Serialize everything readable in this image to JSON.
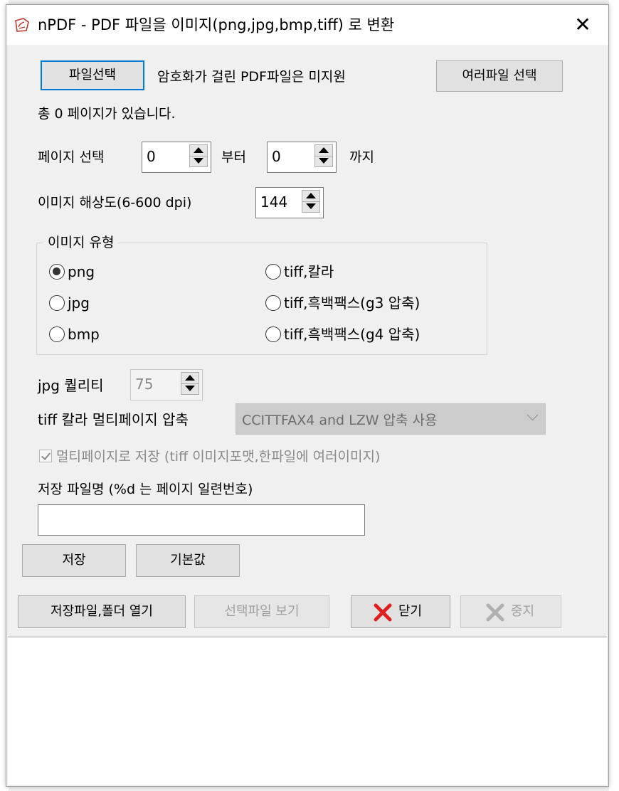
{
  "window": {
    "title": "nPDF - PDF 파일을 이미지(png,jpg,bmp,tiff) 로 변환",
    "close_glyph": "✕"
  },
  "file": {
    "select_button": "파일선택",
    "note": "암호화가 걸린 PDF파일은 미지원",
    "multi_select_button": "여러파일 선택",
    "page_count_text": "총 0 페이지가 있습니다."
  },
  "page_range": {
    "label": "페이지 선택",
    "from_value": "0",
    "from_suffix": "부터",
    "to_value": "0",
    "to_suffix": "까지"
  },
  "resolution": {
    "label": "이미지 해상도(6-600 dpi)",
    "value": "144"
  },
  "image_type": {
    "group_label": "이미지 유형",
    "options": [
      {
        "label": "png",
        "selected": true
      },
      {
        "label": "jpg",
        "selected": false
      },
      {
        "label": "bmp",
        "selected": false
      },
      {
        "label": "tiff,칼라",
        "selected": false
      },
      {
        "label": "tiff,흑백팩스(g3 압축)",
        "selected": false
      },
      {
        "label": "tiff,흑백팩스(g4 압축)",
        "selected": false
      }
    ]
  },
  "jpg_quality": {
    "label": "jpg 퀄리티",
    "value": "75"
  },
  "tiff_compression": {
    "label": "tiff 칼라 멀티페이지 압축",
    "selected": "CCITTFAX4 and LZW 압축 사용"
  },
  "multipage": {
    "label": "멀티페이지로 저장 (tiff 이미지포맷,한파일에 여러이미지)",
    "checked": true
  },
  "filename": {
    "label": "저장 파일명 (%d 는 페이지 일련번호)",
    "value": ""
  },
  "actions": {
    "save": "저장",
    "defaults": "기본값",
    "open_folder": "저장파일,폴더 열기",
    "view_selected": "선택파일 보기",
    "close": "닫기",
    "stop": "중지"
  },
  "colors": {
    "focus_border": "#0078d7",
    "close_icon_red": "#e02020",
    "disabled_text": "#a0a0a0"
  }
}
